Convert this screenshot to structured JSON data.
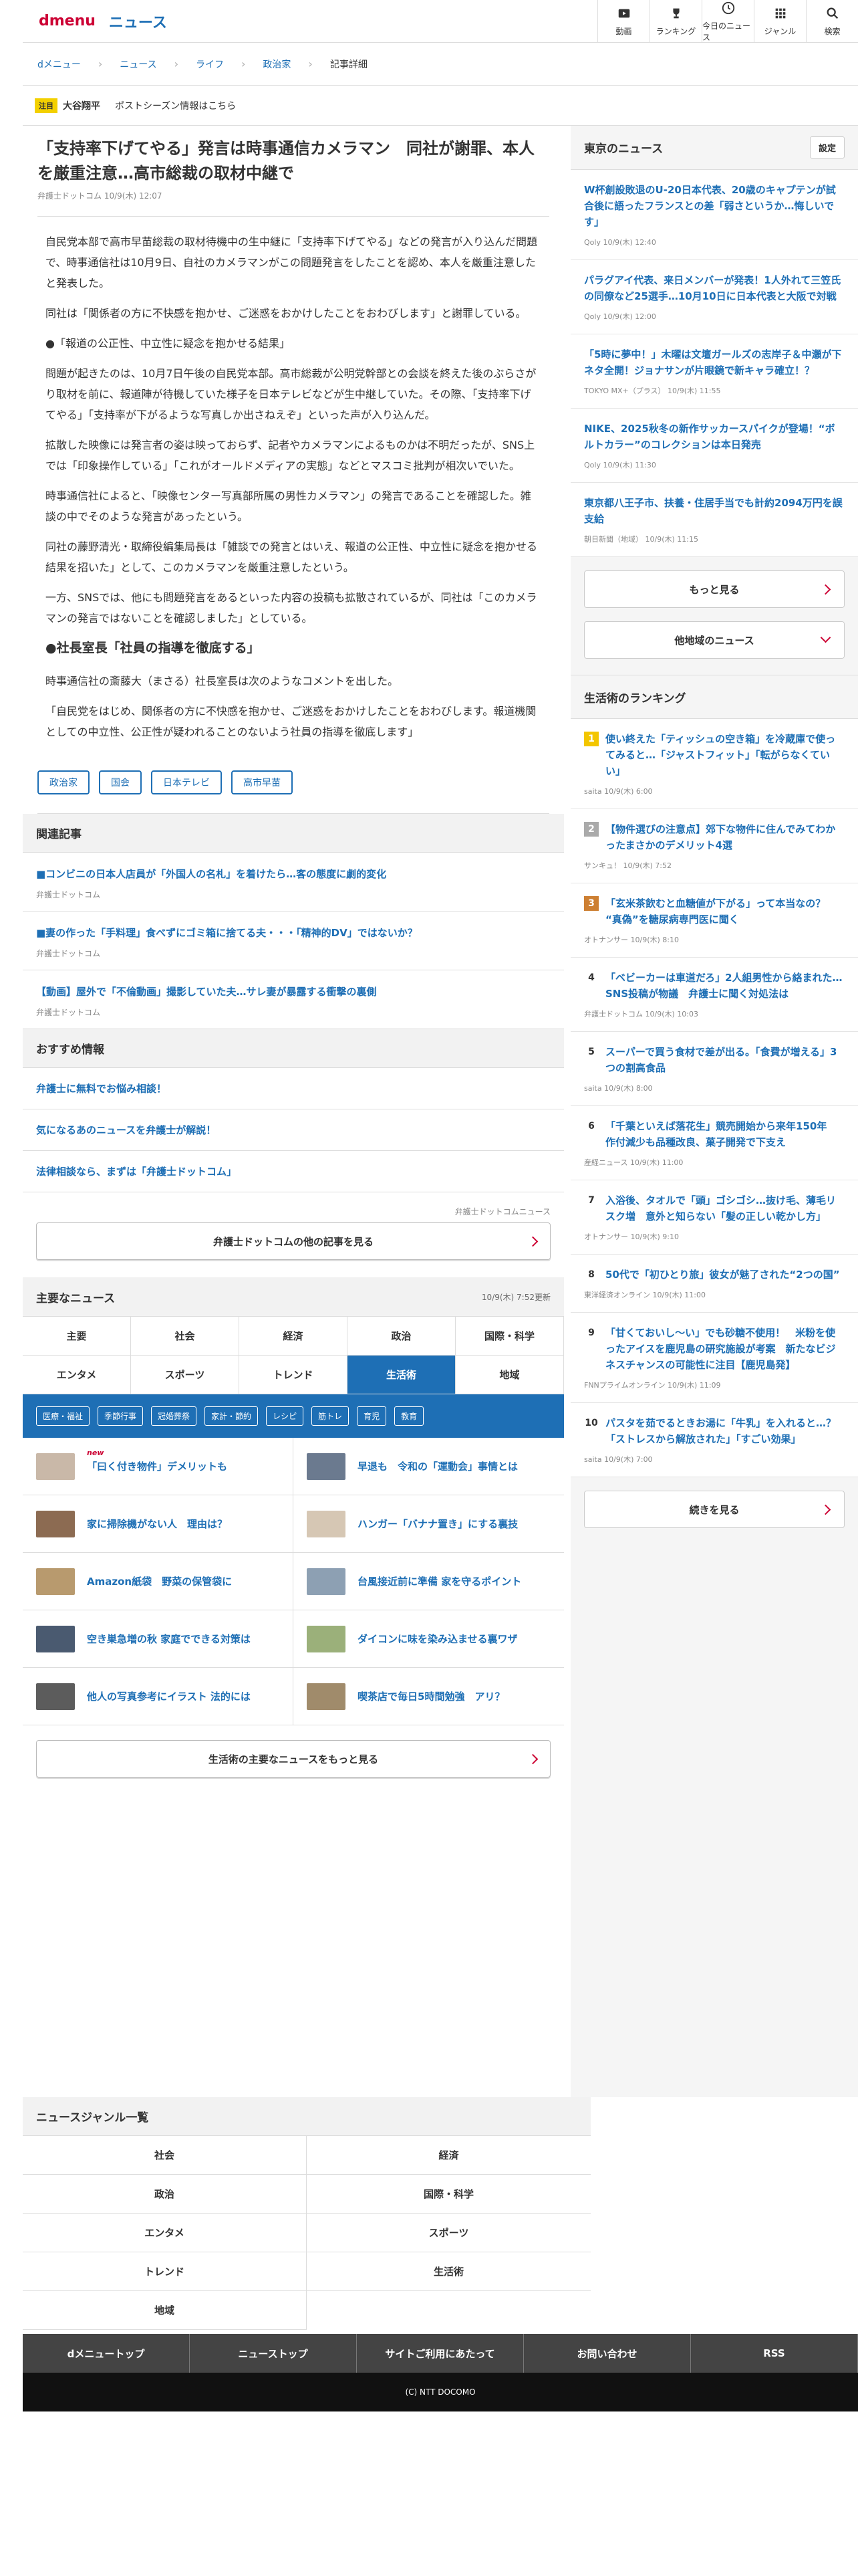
{
  "header": {
    "logo_d": "dmenu",
    "logo_news": "ニュース",
    "nav": [
      {
        "label": "動画",
        "icon": "video-icon"
      },
      {
        "label": "ランキング",
        "icon": "trophy-icon"
      },
      {
        "label": "今日のニュース",
        "icon": "clock-icon"
      },
      {
        "label": "ジャンル",
        "icon": "grid-icon"
      },
      {
        "label": "検索",
        "icon": "search-icon"
      }
    ]
  },
  "breadcrumb": [
    "dメニュー",
    "ニュース",
    "ライフ",
    "政治家",
    "記事詳細"
  ],
  "notice": {
    "badge": "注目",
    "name": "大谷翔平",
    "text": "ポストシーズン情報はこちら"
  },
  "article": {
    "title": "「支持率下げてやる」発言は時事通信カメラマン　同社が謝罪、本人を厳重注意…高市総裁の取材中継で",
    "meta": "弁護士ドットコム 10/9(木) 12:07",
    "p": [
      "自民党本部で高市早苗総裁の取材待機中の生中継に「支持率下げてやる」などの発言が入り込んだ問題で、時事通信社は10月9日、自社のカメラマンがこの問題発言をしたことを認め、本人を厳重注意したと発表した。",
      "同社は「関係者の方に不快感を抱かせ、ご迷惑をおかけしたことをおわびします」と謝罪している。",
      "●「報道の公正性、中立性に疑念を抱かせる結果」",
      "問題が起きたのは、10月7日午後の自民党本部。高市総裁が公明党幹部との会談を終えた後のぶらさがり取材を前に、報道陣が待機していた様子を日本テレビなどが生中継していた。その際、「支持率下げてやる」「支持率が下がるような写真しか出さねえぞ」といった声が入り込んだ。",
      "拡散した映像には発言者の姿は映っておらず、記者やカメラマンによるものかは不明だったが、SNS上では「印象操作している」「これがオールドメディアの実態」などとマスコミ批判が相次いでいた。",
      "時事通信社によると、「映像センター写真部所属の男性カメラマン」の発言であることを確認した。雑談の中でそのような発言があったという。",
      "同社の藤野清光・取締役編集局長は「雑談での発言とはいえ、報道の公正性、中立性に疑念を抱かせる結果を招いた」として、このカメラマンを厳重注意したという。",
      "一方、SNSでは、他にも問題発言をあるといった内容の投稿も拡散されているが、同社は「このカメラマンの発言ではないことを確認しました」としている。"
    ],
    "h3": "●社長室長「社員の指導を徹底する」",
    "p2": [
      "時事通信社の斎藤大（まさる）社長室長は次のようなコメントを出した。",
      "「自民党をはじめ、関係者の方に不快感を抱かせ、ご迷惑をおかけしたことをおわびします。報道機関としての中立性、公正性が疑われることのないよう社員の指導を徹底します」"
    ],
    "tags": [
      "政治家",
      "国会",
      "日本テレビ",
      "高市早苗"
    ]
  },
  "related": {
    "heading": "関連記事",
    "items": [
      {
        "title": "■コンビニの日本人店員が「外国人の名札」を着けたら…客の態度に劇的変化",
        "src": "弁護士ドットコム"
      },
      {
        "title": "■妻の作った「手料理」食べずにゴミ箱に捨てる夫・・・「精神的DV」ではないか？",
        "src": "弁護士ドットコム"
      },
      {
        "title": "【動画】屋外で「不倫動画」撮影していた夫…サレ妻が暴露する衝撃の裏側",
        "src": "弁護士ドットコム"
      }
    ]
  },
  "recommend": {
    "heading": "おすすめ情報",
    "items": [
      "弁護士に無料でお悩み相談！",
      "気になるあのニュースを弁護士が解説！",
      "法律相談なら、まずは「弁護士ドットコム」"
    ],
    "provider": "弁護士ドットコムニュース",
    "more": "弁護士ドットコムの他の記事を見る"
  },
  "major": {
    "heading": "主要なニュース",
    "updated": "10/9(木) 7:52更新",
    "tabs": [
      "主要",
      "社会",
      "経済",
      "政治",
      "国際・科学",
      "エンタメ",
      "スポーツ",
      "トレンド",
      "生活術",
      "地域"
    ],
    "subtabs": [
      "医療・福祉",
      "季節行事",
      "冠婚葬祭",
      "家計・節約",
      "レシピ",
      "筋トレ",
      "育児",
      "教育"
    ],
    "items": [
      "「曰く付き物件」デメリットも",
      "早退も　令和の「運動会」事情とは",
      "家に掃除機がない人　理由は？",
      "ハンガー「バナナ置き」にする裏技",
      "Amazon紙袋　野菜の保管袋に",
      "台風接近前に準備 家を守るポイント",
      "空き巣急増の秋 家庭でできる対策は",
      "ダイコンに味を染み込ませる裏ワザ",
      "他人の写真参考にイラスト 法的には",
      "喫茶店で毎日5時間勉強　アリ？"
    ],
    "new_label": "new",
    "more": "生活術の主要なニュースをもっと見る"
  },
  "side": {
    "local_heading": "東京のニュース",
    "settings": "設定",
    "local": [
      {
        "title": "W杯創設敗退のU-20日本代表、20歳のキャプテンが試合後に語ったフランスとの差「弱さというか…悔しいです」",
        "src": "Qoly 10/9(木) 12:40"
      },
      {
        "title": "パラグアイ代表、来日メンバーが発表！1人外れて三笠氏の同僚など25選手…10月10日に日本代表と大阪で対戦",
        "src": "Qoly 10/9(木) 12:00"
      },
      {
        "title": "「5時に夢中！」木曜は文壇ガールズの志岸子＆中瀬が下ネタ全開！ジョナサンが片眼鏡で新キャラ確立！？",
        "src": "TOKYO MX+（プラス） 10/9(木) 11:55"
      },
      {
        "title": "NIKE、2025秋冬の新作サッカースパイクが登場！“ボルトカラー”のコレクションは本日発売",
        "src": "Qoly 10/9(木) 11:30"
      },
      {
        "title": "東京都八王子市、扶養・住居手当でも計約2094万円を誤支給",
        "src": "朝日新聞（地域） 10/9(木) 11:15"
      }
    ],
    "more": "もっと見る",
    "other": "他地域のニュース",
    "rank_heading": "生活術のランキング",
    "rank": [
      {
        "n": "1",
        "title": "使い終えた「ティッシュの空き箱」を冷蔵庫で使ってみると…「ジャストフィット」「転がらなくていい」",
        "src": "saita 10/9(木) 6:00"
      },
      {
        "n": "2",
        "title": "【物件選びの注意点】郊下な物件に住んでみてわかったまさかのデメリット4選",
        "src": "サンキュ！ 10/9(木) 7:52"
      },
      {
        "n": "3",
        "title": "「玄米茶飲むと血糖値が下がる」って本当なの？ “真偽”を糖尿病専門医に聞く",
        "src": "オトナンサー 10/9(木) 8:10"
      },
      {
        "n": "4",
        "title": "「ベビーカーは車道だろ」2人組男性から絡まれた…SNS投稿が物議　弁護士に聞く対処法は",
        "src": "弁護士ドットコム 10/9(木) 10:03"
      },
      {
        "n": "5",
        "title": "スーパーで買う食材で差が出る。「食費が増える」3つの割高食品",
        "src": "saita 10/9(木) 8:00"
      },
      {
        "n": "6",
        "title": "「千葉といえば落花生」競売開始から来年150年　作付減少も品種改良、菓子開発で下支え",
        "src": "産経ニュース 10/9(木) 11:00"
      },
      {
        "n": "7",
        "title": "入浴後、タオルで「頭」ゴシゴシ…抜け毛、薄毛リスク増　意外と知らない「髪の正しい乾かし方」",
        "src": "オトナンサー 10/9(木) 9:10"
      },
      {
        "n": "8",
        "title": "50代で「初ひとり旅」彼女が魅了された“2つの国”",
        "src": "東洋経済オンライン 10/9(木) 11:00"
      },
      {
        "n": "9",
        "title": "「甘くておいし〜い」でも砂糖不使用！　米粉を使ったアイスを鹿児島の研究施設が考案　新たなビジネスチャンスの可能性に注目【鹿児島発】",
        "src": "FNNプライムオンライン 10/9(木) 11:09"
      },
      {
        "n": "10",
        "title": "パスタを茹でるときお湯に「牛乳」を入れると…？「ストレスから解放された」「すごい効果」",
        "src": "saita 10/9(木) 7:00"
      }
    ],
    "rank_more": "続きを見る"
  },
  "genre": {
    "heading": "ニュースジャンル一覧",
    "items": [
      "社会",
      "経済",
      "政治",
      "国際・科学",
      "エンタメ",
      "スポーツ",
      "トレンド",
      "生活術",
      "地域"
    ]
  },
  "footer": {
    "nav": [
      "dメニュートップ",
      "ニューストップ",
      "サイトご利用にあたって",
      "お問い合わせ",
      "RSS"
    ],
    "copy": "(C) NTT DOCOMO"
  },
  "colors": {
    "accent": "#1e6fb5",
    "brand": "#cc0033",
    "rank1": "#f3c600",
    "rank2": "#aaaaaa",
    "rank3": "#cd7f32"
  }
}
